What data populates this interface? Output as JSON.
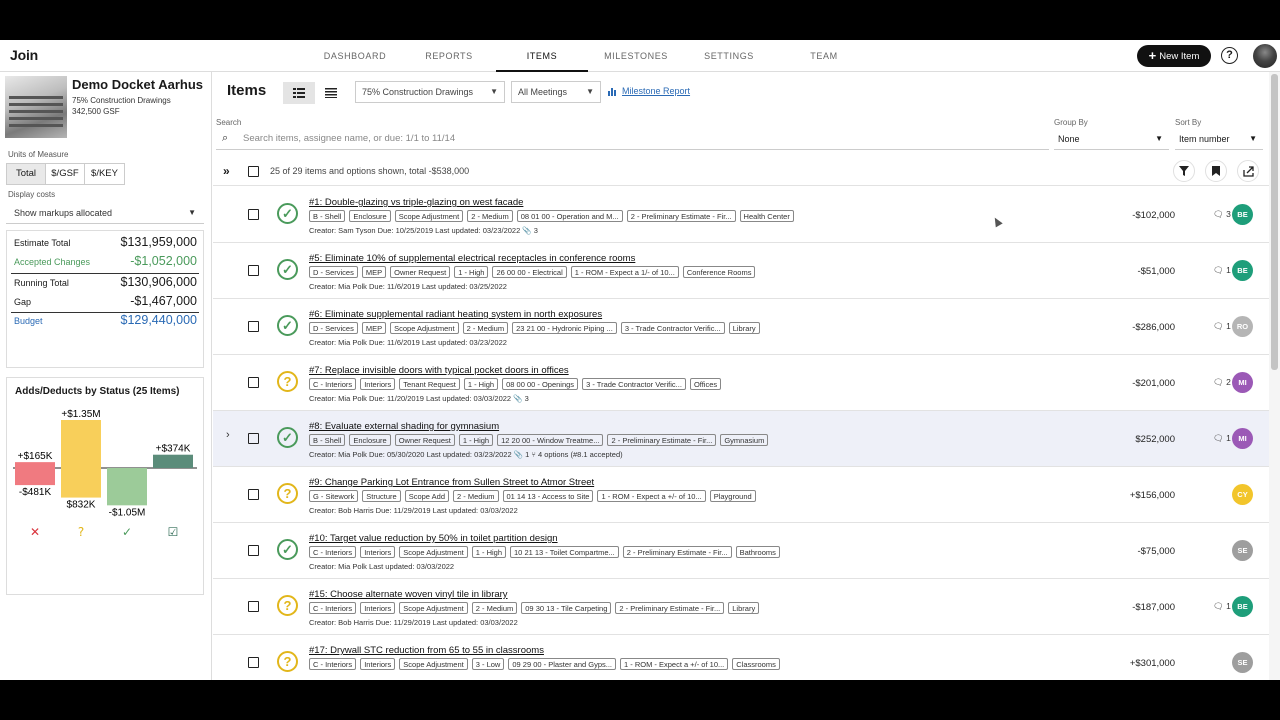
{
  "app": {
    "logo": "Join"
  },
  "nav": {
    "tabs": [
      "DASHBOARD",
      "REPORTS",
      "ITEMS",
      "MILESTONES",
      "SETTINGS",
      "TEAM"
    ],
    "active": "ITEMS"
  },
  "new_item_label": "New Item",
  "project": {
    "name": "Demo Docket Aarhus",
    "milestone": "75% Construction Drawings",
    "area": "342,500 GSF"
  },
  "units": {
    "label": "Units of Measure",
    "options": [
      "Total",
      "$/GSF",
      "$/KEY"
    ],
    "active": "Total"
  },
  "display_costs": {
    "label": "Display costs",
    "value": "Show markups allocated"
  },
  "totals": [
    {
      "label": "Estimate Total",
      "value": "$131,959,000",
      "color": "#1a1a1a"
    },
    {
      "label": "Accepted Changes",
      "value": "-$1,052,000",
      "color": "#4a9a5b"
    },
    {
      "label": "Running Total",
      "value": "$130,906,000",
      "color": "#1a1a1a"
    },
    {
      "label": "Gap",
      "value": "-$1,467,000",
      "color": "#1a1a1a"
    },
    {
      "label": "Budget",
      "value": "$129,440,000",
      "color": "#2a6ab5"
    }
  ],
  "adds_deducts": {
    "title": "Adds/Deducts by Status (25 Items)",
    "bars": [
      {
        "status": "rejected",
        "add": "+$165K",
        "deduct": "-$481K",
        "add_value": 165,
        "deduct_value": 481,
        "color": "#f07a80"
      },
      {
        "status": "pending",
        "add": "+$1.35M",
        "deduct": "$832K",
        "add_value": 1350,
        "deduct_value": 832,
        "color": "#f8cf5a"
      },
      {
        "status": "accepted",
        "add": "",
        "deduct": "-$1.05M",
        "add_value": 0,
        "deduct_value": 1050,
        "color": "#9ccb99"
      },
      {
        "status": "incorporated",
        "add": "+$374K",
        "deduct": "",
        "add_value": 374,
        "deduct_value": 0,
        "color": "#5b8c7a"
      }
    ]
  },
  "toolbar": {
    "title": "Items",
    "milestone_select": "75% Construction Drawings",
    "meeting_select": "All Meetings",
    "milestone_report_link": "Milestone Report",
    "search_label": "Search",
    "search_placeholder": "Search items, assignee name, or due: 1/1 to 11/14",
    "group_by_label": "Group By",
    "group_by_value": "None",
    "sort_by_label": "Sort By",
    "sort_by_value": "Item number"
  },
  "summary": "25 of 29 items and options shown, total -$538,000",
  "items": [
    {
      "status": "accepted",
      "title": "#1: Double-glazing vs triple-glazing on west facade",
      "chips": [
        "B - Shell",
        "Enclosure",
        "Scope Adjustment",
        "2 - Medium",
        "08 01 00 - Operation and M...",
        "2 - Preliminary Estimate - Fir...",
        "Health Center"
      ],
      "meta": "Creator: Sam Tyson   Due: 10/25/2019   Last updated: 03/23/2022   📎 3",
      "cost": "-$102,000",
      "comments": "🗨 3",
      "avatar": "BE",
      "avatar_color": "#1e9e7a",
      "expand": ""
    },
    {
      "status": "accepted",
      "title": "#5: Eliminate 10% of supplemental electrical receptacles in conference rooms",
      "chips": [
        "D - Services",
        "MEP",
        "Owner Request",
        "1 - High",
        "26 00 00 - Electrical",
        "1 - ROM - Expect a 1/- of 10...",
        "Conference Rooms"
      ],
      "meta": "Creator: Mia Polk   Due: 11/6/2019   Last updated: 03/25/2022",
      "cost": "-$51,000",
      "comments": "🗨 1",
      "avatar": "BE",
      "avatar_color": "#1e9e7a",
      "expand": ""
    },
    {
      "status": "accepted",
      "title": "#6: Eliminate supplemental radiant heating system in north exposures",
      "chips": [
        "D - Services",
        "MEP",
        "Scope Adjustment",
        "2 - Medium",
        "23 21 00 - Hydronic Piping ...",
        "3 - Trade Contractor Verific...",
        "Library"
      ],
      "meta": "Creator: Mia Polk   Due: 11/6/2019   Last updated: 03/23/2022",
      "cost": "-$286,000",
      "comments": "🗨 1",
      "avatar": "RO",
      "avatar_color": "#b5b5b5",
      "expand": ""
    },
    {
      "status": "pending",
      "title": "#7: Replace invisible doors with typical pocket doors in offices",
      "chips": [
        "C - Interiors",
        "Interiors",
        "Tenant Request",
        "1 - High",
        "08 00 00 - Openings",
        "3 - Trade Contractor Verific...",
        "Offices"
      ],
      "meta": "Creator: Mia Polk   Due: 11/20/2019   Last updated: 03/03/2022   📎 3",
      "cost": "-$201,000",
      "comments": "🗨 2",
      "avatar": "MI",
      "avatar_color": "#9b59b6",
      "expand": ""
    },
    {
      "status": "accepted",
      "title": "#8: Evaluate external shading for gymnasium",
      "chips": [
        "B - Shell",
        "Enclosure",
        "Owner Request",
        "1 - High",
        "12 20 00 - Window Treatme...",
        "2 - Preliminary Estimate - Fir...",
        "Gymnasium"
      ],
      "meta": "Creator: Mia Polk   Due: 05/30/2020   Last updated: 03/23/2022   📎 1   ⑂ 4 options (#8.1 accepted)",
      "cost": "$252,000",
      "comments": "🗨 1",
      "avatar": "MI",
      "avatar_color": "#9b59b6",
      "expand": "›",
      "highlight": true
    },
    {
      "status": "pending",
      "title": "#9: Change Parking Lot Entrance from Sullen Street to Atmor Street",
      "chips": [
        "G - Sitework",
        "Structure",
        "Scope Add",
        "2 - Medium",
        "01 14 13 - Access to Site",
        "1 - ROM - Expect a +/- of 10...",
        "Playground"
      ],
      "meta": "Creator: Bob Harris   Due: 11/29/2019   Last updated: 03/03/2022",
      "cost": "+$156,000",
      "comments": "",
      "avatar": "CY",
      "avatar_color": "#f2c52b",
      "expand": ""
    },
    {
      "status": "accepted",
      "title": "#10: Target value reduction by 50% in toilet partition design",
      "chips": [
        "C - Interiors",
        "Interiors",
        "Scope Adjustment",
        "1 - High",
        "10 21 13 - Toilet Compartme...",
        "2 - Preliminary Estimate - Fir...",
        "Bathrooms"
      ],
      "meta": "Creator: Mia Polk   Last updated: 03/03/2022",
      "cost": "-$75,000",
      "comments": "",
      "avatar": "SE",
      "avatar_color": "#9e9e9e",
      "expand": ""
    },
    {
      "status": "pending",
      "title": "#15: Choose alternate woven vinyl tile in library",
      "chips": [
        "C - Interiors",
        "Interiors",
        "Scope Adjustment",
        "2 - Medium",
        "09 30 13 - Tile Carpeting",
        "2 - Preliminary Estimate - Fir...",
        "Library"
      ],
      "meta": "Creator: Bob Harris   Due: 11/29/2019   Last updated: 03/03/2022",
      "cost": "-$187,000",
      "comments": "🗨 1",
      "avatar": "BE",
      "avatar_color": "#1e9e7a",
      "expand": ""
    },
    {
      "status": "pending",
      "title": "#17: Drywall STC reduction from 65 to 55 in classrooms",
      "chips": [
        "C - Interiors",
        "Interiors",
        "Scope Adjustment",
        "3 - Low",
        "09 29 00 - Plaster and Gyps...",
        "1 - ROM - Expect a +/- of 10...",
        "Classrooms"
      ],
      "meta": "",
      "cost": "+$301,000",
      "comments": "",
      "avatar": "SE",
      "avatar_color": "#9e9e9e",
      "expand": ""
    }
  ]
}
